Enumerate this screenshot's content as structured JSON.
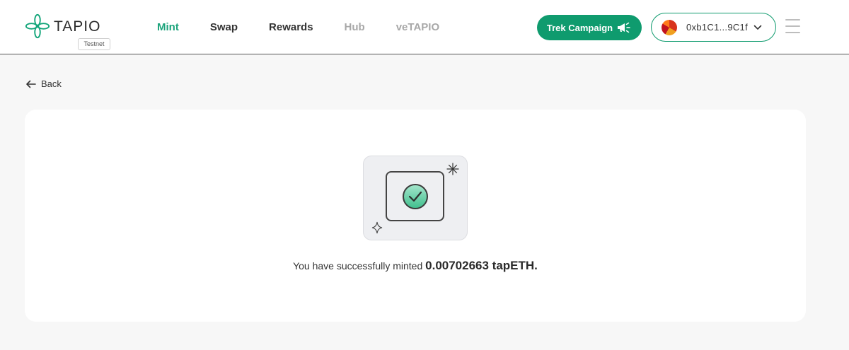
{
  "brand": {
    "name": "TAPIO",
    "network_badge": "Testnet",
    "accent_color": "#0f9b6e",
    "logo_icon": "tapio-flower-logo-icon"
  },
  "nav": {
    "items": [
      {
        "label": "Mint",
        "state": "active"
      },
      {
        "label": "Swap",
        "state": "normal"
      },
      {
        "label": "Rewards",
        "state": "normal"
      },
      {
        "label": "Hub",
        "state": "disabled"
      },
      {
        "label": "veTAPIO",
        "state": "disabled"
      }
    ]
  },
  "header": {
    "campaign_button": "Trek Campaign",
    "campaign_icon": "megaphone-icon",
    "wallet_address": "0xb1C1...9C1f",
    "wallet_icon": "chevron-down-icon",
    "menu_icon": "hamburger-menu-icon"
  },
  "page": {
    "back_label": "Back",
    "back_icon": "arrow-left-icon"
  },
  "result": {
    "message_prefix": "You have successfully minted",
    "amount": "0.00702663 tapETH.",
    "illustration_icon": "check-circle-icon"
  }
}
